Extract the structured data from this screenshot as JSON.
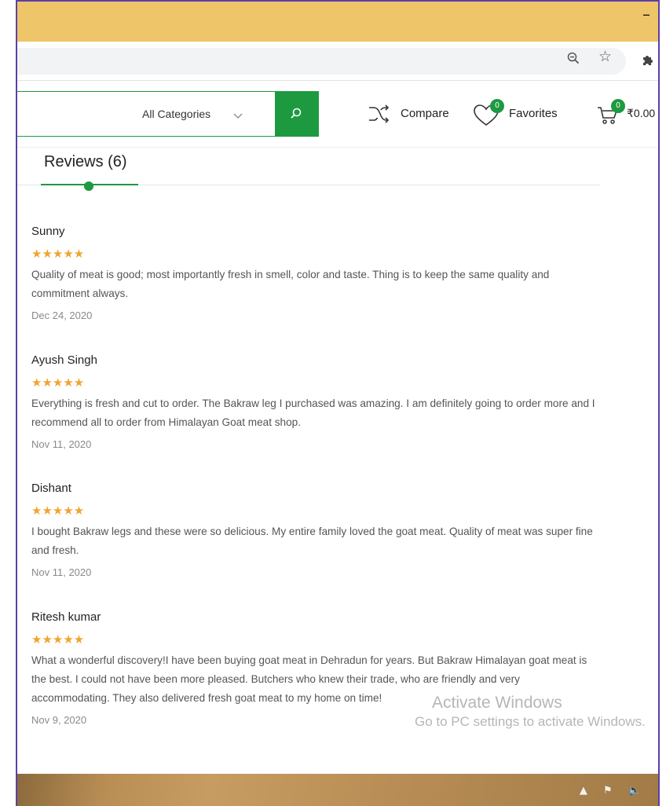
{
  "shop": {
    "category_label": "All Categories",
    "compare_label": "Compare",
    "favorites_label": "Favorites",
    "favorites_count": "0",
    "cart_count": "0",
    "cart_total": "₹0.00"
  },
  "reviews": {
    "tab_title": "Reviews (6)",
    "items": [
      {
        "name": "Sunny",
        "rating": 5,
        "stars": "★★★★★",
        "text": "Quality of meat is good; most importantly fresh in smell, color and taste. Thing is to keep the same quality and commitment always.",
        "date": "Dec 24, 2020"
      },
      {
        "name": "Ayush Singh",
        "rating": 5,
        "stars": "★★★★★",
        "text": "Everything is fresh and cut to order. The Bakraw leg I purchased was amazing. I am definitely going to order more and I recommend all to order from Himalayan Goat meat shop.",
        "date": "Nov 11, 2020"
      },
      {
        "name": "Dishant",
        "rating": 5,
        "stars": "★★★★★",
        "text": "I bought Bakraw legs and these were so delicious. My entire family loved the goat meat. Quality of meat was super fine and fresh.",
        "date": "Nov 11, 2020"
      },
      {
        "name": "Ritesh kumar",
        "rating": 5,
        "stars": "★★★★★",
        "text": "What a wonderful discovery!I have been buying goat meat in Dehradun for years. But Bakraw Himalayan goat meat is the best. I could not have been more pleased. Butchers who knew their trade, who are friendly and very accommodating. They also delivered fresh goat meat to my home on time!",
        "date": "Nov 9, 2020"
      }
    ]
  },
  "watermark": {
    "title": "Activate Windows",
    "subtitle": "Go to PC settings to activate Windows."
  },
  "colors": {
    "accent": "#1d9a40",
    "star": "#f0a530",
    "titlebar": "#efc56a",
    "window_border": "#5b3fa6"
  }
}
